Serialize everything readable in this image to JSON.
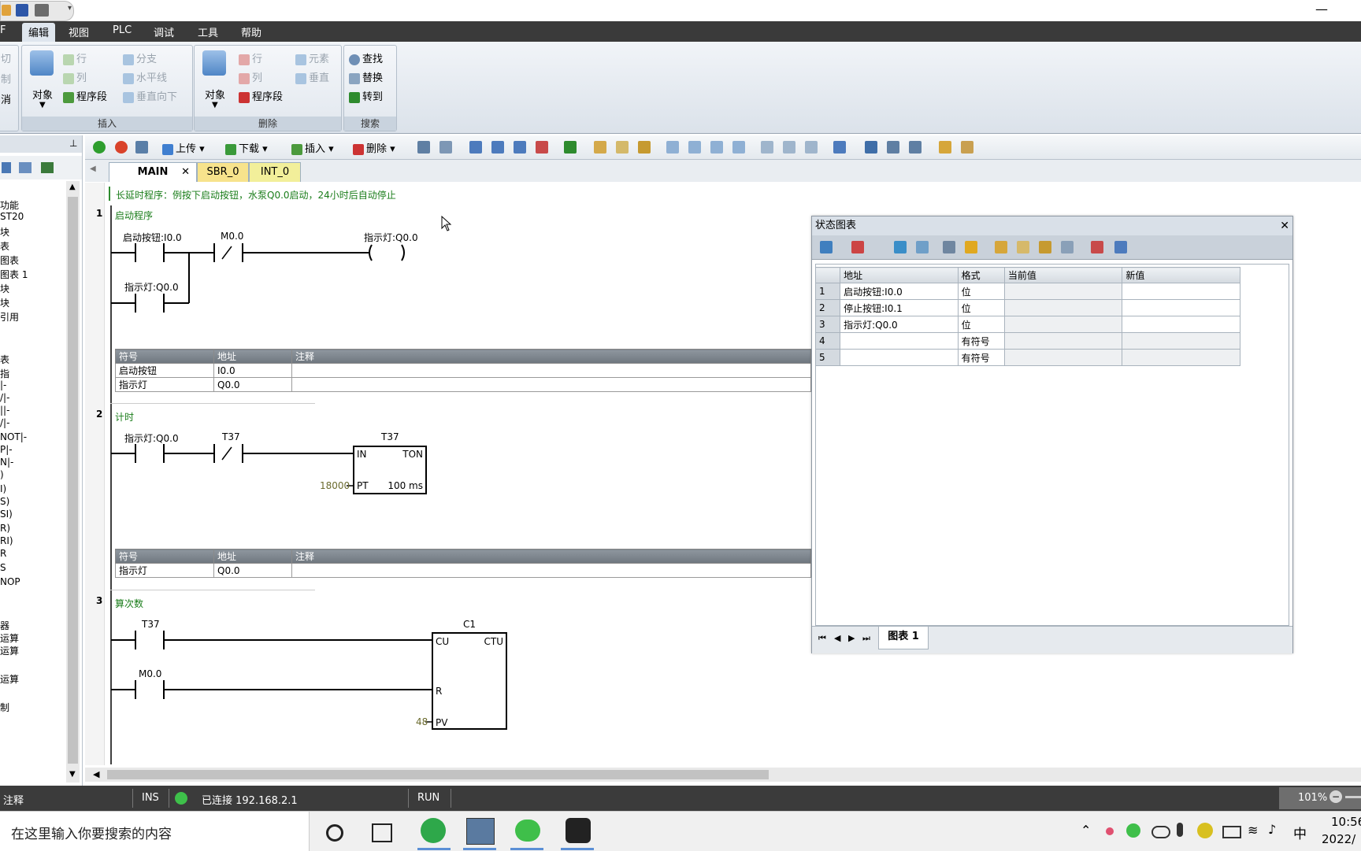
{
  "menu": [
    "F",
    "编辑",
    "视图",
    "PLC",
    "调试",
    "工具",
    "帮助"
  ],
  "ribbon": {
    "left_edge": [
      "切",
      "制",
      "消"
    ],
    "insert": {
      "object": "对象",
      "row": "行",
      "col": "列",
      "segment": "程序段",
      "branch": "分支",
      "hline": "水平线",
      "vdown": "垂直向下",
      "label": "插入"
    },
    "delete": {
      "object": "对象",
      "row": "行",
      "col": "列",
      "segment": "程序段",
      "element": "元素",
      "vertical": "垂直",
      "label": "删除"
    },
    "search": {
      "find": "查找",
      "replace": "替换",
      "goto": "转到",
      "label": "搜索"
    }
  },
  "toolbar": {
    "upload": "上传",
    "download": "下载",
    "insert": "插入",
    "delete": "删除"
  },
  "tabs": [
    "MAIN",
    "SBR_0",
    "INT_0"
  ],
  "leftpanel": [
    "功能",
    "ST20",
    "块",
    "表",
    "图表",
    "图表 1",
    "块",
    "块",
    "引用",
    "表",
    "指",
    "|-",
    "/|-",
    "||-",
    "/|-",
    "NOT|-",
    "P|-",
    "N|-",
    ")",
    "I)",
    "S)",
    "SI)",
    "R)",
    "RI)",
    "R",
    "S",
    "NOP",
    "器",
    "运算",
    "运算",
    "运算",
    "制"
  ],
  "program": {
    "header_comment": "长延时程序：例按下启动按钮，水泵Q0.0启动，24小时后自动停止",
    "rung1": {
      "num": "1",
      "title": "启动程序",
      "c1": "启动按钮:I0.0",
      "c2": "M0.0",
      "coil": "指示灯:Q0.0",
      "c3": "指示灯:Q0.0"
    },
    "symtable_header": {
      "sym": "符号",
      "addr": "地址",
      "note": "注释"
    },
    "rung1_rows": [
      {
        "sym": "启动按钮",
        "addr": "I0.0"
      },
      {
        "sym": "指示灯",
        "addr": "Q0.0"
      }
    ],
    "rung2": {
      "num": "2",
      "title": "计时",
      "c1": "指示灯:Q0.0",
      "c2": "T37",
      "box": "T37",
      "in": "IN",
      "ton": "TON",
      "pt": "PT",
      "preset": "18000",
      "base": "100 ms"
    },
    "rung2_rows": [
      {
        "sym": "指示灯",
        "addr": "Q0.0"
      }
    ],
    "rung3": {
      "num": "3",
      "title": "算次数",
      "c1": "T37",
      "c2": "M0.0",
      "box": "C1",
      "cu": "CU",
      "ctu": "CTU",
      "r": "R",
      "pv": "PV",
      "preset": "48"
    }
  },
  "statuschart": {
    "title": "状态图表",
    "headers": [
      "地址",
      "格式",
      "当前值",
      "新值"
    ],
    "rows": [
      {
        "num": "1",
        "addr": "启动按钮:I0.0",
        "fmt": "位"
      },
      {
        "num": "2",
        "addr": "停止按钮:I0.1",
        "fmt": "位"
      },
      {
        "num": "3",
        "addr": "指示灯:Q0.0",
        "fmt": "位"
      },
      {
        "num": "4",
        "addr": "",
        "fmt": "有符号"
      },
      {
        "num": "5",
        "addr": "",
        "fmt": "有符号"
      }
    ],
    "sheet_tab": "图表 1"
  },
  "status": {
    "mode": "注释",
    "ins": "INS",
    "conn": "已连接 192.168.2.1",
    "run": "RUN",
    "zoom": "101%"
  },
  "taskbar": {
    "search": "在这里输入你要搜索的内容",
    "ime": "中",
    "time": "10:56",
    "date": "2022/"
  }
}
